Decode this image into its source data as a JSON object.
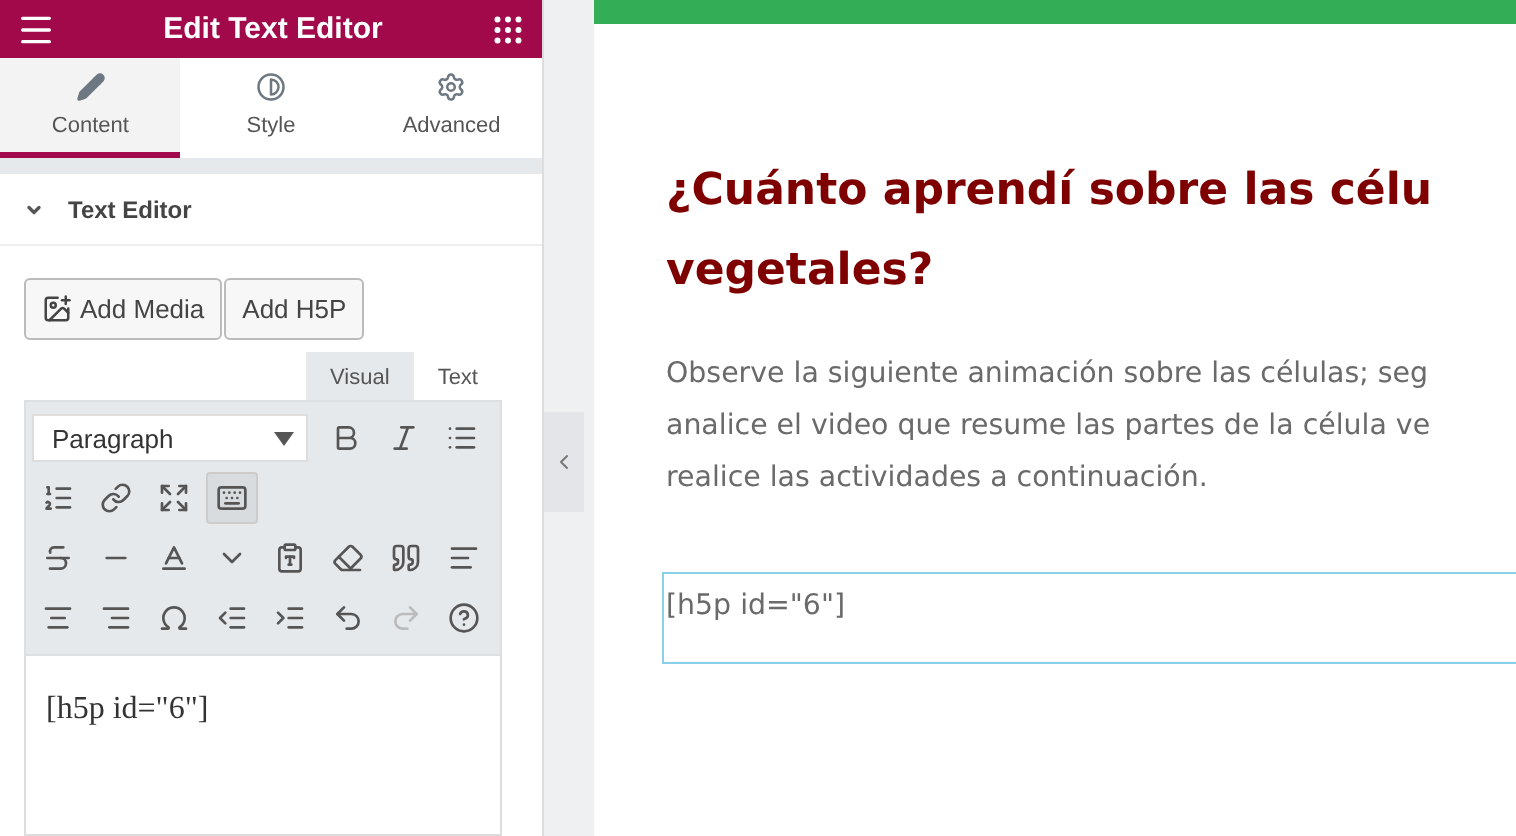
{
  "panel": {
    "title": "Edit Text Editor",
    "tabs": [
      {
        "label": "Content",
        "selected": true
      },
      {
        "label": "Style",
        "selected": false
      },
      {
        "label": "Advanced",
        "selected": false
      }
    ],
    "section": {
      "title": "Text Editor",
      "expanded": true
    },
    "media_buttons": [
      {
        "label": "Add Media"
      },
      {
        "label": "Add H5P"
      }
    ],
    "editor_tabs": [
      {
        "label": "Visual",
        "selected": true
      },
      {
        "label": "Text",
        "selected": false
      }
    ],
    "format_select": {
      "value": "Paragraph"
    },
    "toolbar_rows": [
      [
        {
          "kind": "bold"
        },
        {
          "kind": "italic"
        },
        {
          "kind": "bullets"
        }
      ],
      [
        {
          "kind": "numbers"
        },
        {
          "kind": "link"
        },
        {
          "kind": "fullscreen"
        },
        {
          "kind": "toolbar-toggle",
          "pressed": true
        }
      ],
      [
        {
          "kind": "strike"
        },
        {
          "kind": "rule"
        },
        {
          "kind": "text-color"
        },
        {
          "kind": "dropdown"
        },
        {
          "kind": "paste"
        },
        {
          "kind": "eraser"
        },
        {
          "kind": "quote"
        },
        {
          "kind": "align-left"
        }
      ],
      [
        {
          "kind": "align-center"
        },
        {
          "kind": "align-right"
        },
        {
          "kind": "omega"
        },
        {
          "kind": "outdent"
        },
        {
          "kind": "indent"
        },
        {
          "kind": "undo",
          "disabled": false
        },
        {
          "kind": "redo",
          "disabled": true
        },
        {
          "kind": "help"
        }
      ]
    ],
    "content": "[h5p id=\"6\"]"
  },
  "page": {
    "heading_lines": [
      "¿Cuánto aprendí sobre las célu",
      "vegetales?"
    ],
    "paragraph_lines": [
      "Observe la siguiente animación sobre las células; seg",
      "analice el video que resume las partes de la célula ve",
      "realice las actividades a continuación."
    ],
    "shortcode": "[h5p id=\"6\"]"
  }
}
